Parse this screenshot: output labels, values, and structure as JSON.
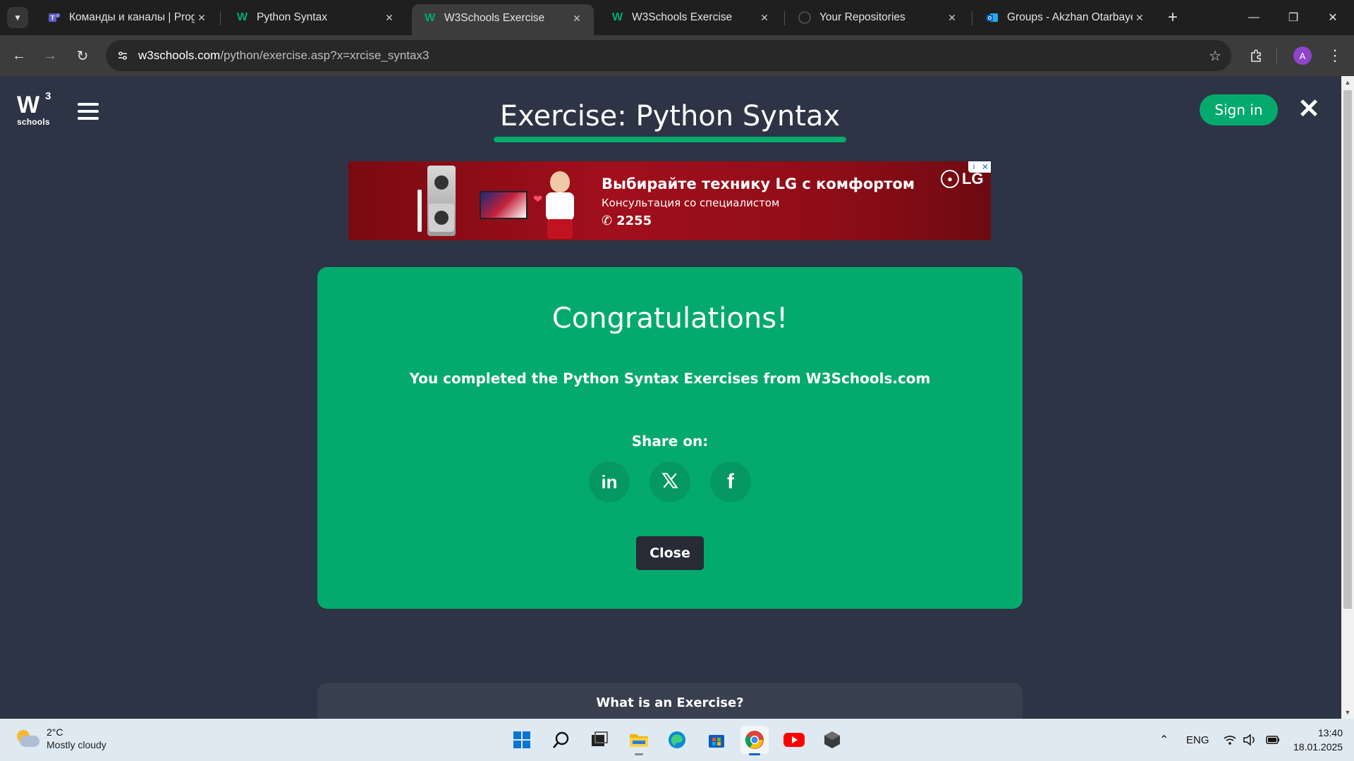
{
  "browser": {
    "tabs": [
      {
        "title": "Команды и каналы | Progr",
        "icon": "teams-icon",
        "active": false
      },
      {
        "title": "Python Syntax",
        "icon": "w3schools-icon",
        "active": false
      },
      {
        "title": "W3Schools Exercise",
        "icon": "w3schools-icon",
        "active": true
      },
      {
        "title": "W3Schools Exercise",
        "icon": "w3schools-icon",
        "active": false
      },
      {
        "title": "Your Repositories",
        "icon": "github-icon",
        "active": false
      },
      {
        "title": "Groups - Akzhan Otarbaye",
        "icon": "outlook-icon",
        "active": false
      }
    ],
    "url_host": "w3schools.com",
    "url_path": "/python/exercise.asp?x=xrcise_syntax3",
    "profile_initial": "A"
  },
  "page": {
    "logo_text": "W",
    "logo_sup": "3",
    "logo_sub": "schools",
    "exercise_title": "Exercise: Python Syntax",
    "progress_fraction": 1.0,
    "sign_in_label": "Sign in",
    "close_glyph": "✕"
  },
  "ad": {
    "headline": "Выбирайте технику LG с комфортом",
    "subline": "Консультация со специалистом",
    "phone": "2255",
    "brand": "LG"
  },
  "card": {
    "title": "Congratulations!",
    "message": "You completed the Python Syntax Exercises from W3Schools.com",
    "share_label": "Share on:",
    "social": [
      {
        "name": "linkedin",
        "glyph": "in"
      },
      {
        "name": "x",
        "glyph": "𝕏"
      },
      {
        "name": "facebook",
        "glyph": "f"
      }
    ],
    "close_label": "Close",
    "color": "#04aa6d"
  },
  "info_card": {
    "title": "What is an Exercise?"
  },
  "taskbar": {
    "weather_temp": "2°C",
    "weather_desc": "Mostly cloudy",
    "language": "ENG",
    "time": "13:40",
    "date": "18.01.2025",
    "apps": [
      "start-icon",
      "search-icon",
      "task-view-icon",
      "file-explorer-icon",
      "edge-icon",
      "store-icon",
      "chrome-icon",
      "youtube-icon",
      "app-icon"
    ]
  }
}
